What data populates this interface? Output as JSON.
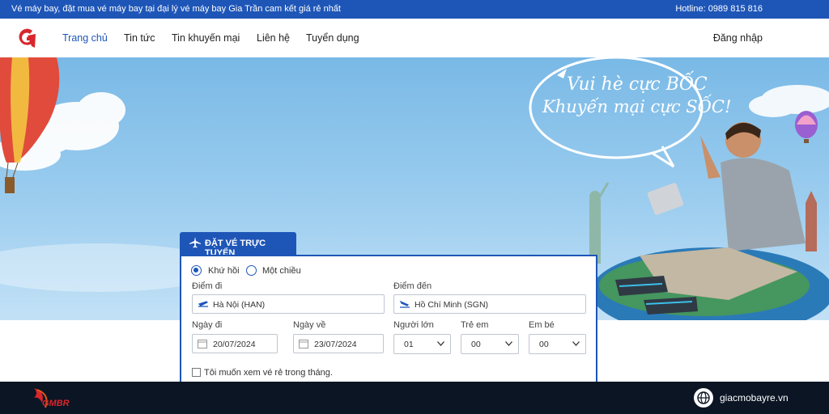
{
  "topbar": {
    "tagline": "Vé máy bay, đặt mua vé máy bay tại đại lý vé máy bay Gia Trần cam kết giá rẻ nhất",
    "hotline": "Hotline: 0989 815 816"
  },
  "nav": {
    "items": [
      "Trang chủ",
      "Tin tức",
      "Tin khuyến mại",
      "Liên hệ",
      "Tuyển dụng"
    ],
    "login": "Đăng nhập"
  },
  "banner": {
    "line1": "Vui hè cực BỐC",
    "line2": "Khuyến mại cực SỐC!"
  },
  "booking": {
    "tab_label": "ĐẶT VÉ TRỰC TUYẾN",
    "trip_round": "Khứ hồi",
    "trip_oneway": "Một chiều",
    "selected_trip": "Khứ hồi",
    "from_label": "Điểm đi",
    "from_value": "Hà Nội (HAN)",
    "to_label": "Điểm đến",
    "to_value": "Hồ Chí Minh (SGN)",
    "depart_label": "Ngày đi",
    "depart_value": "20/07/2024",
    "return_label": "Ngày về",
    "return_value": "23/07/2024",
    "adult_label": "Người lớn",
    "adult_value": "01",
    "child_label": "Trẻ em",
    "child_value": "00",
    "infant_label": "Em bé",
    "infant_value": "00",
    "cheap_month_label": "Tôi muốn xem vé rẻ trong tháng."
  },
  "footer": {
    "logo_text": "GMBR",
    "site": "giacmobayre.vn"
  },
  "colors": {
    "brand_blue": "#1e56b8",
    "footer_bg": "#0b1524",
    "logo_red": "#d9262c"
  }
}
